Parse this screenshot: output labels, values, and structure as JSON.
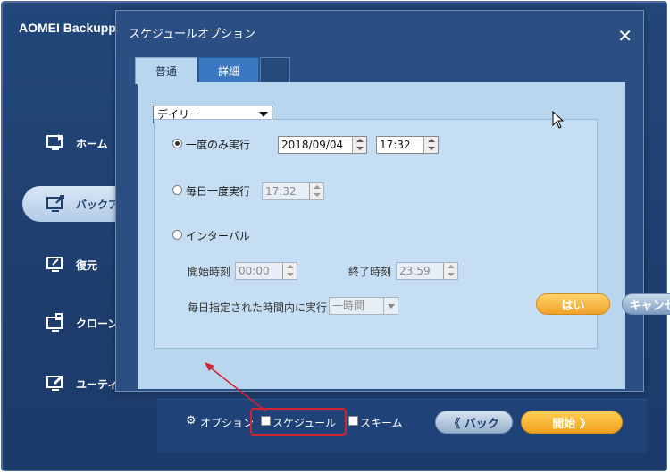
{
  "main": {
    "title": "AOMEI Backupper",
    "nav": [
      {
        "label": "ホーム",
        "icon": "home-icon"
      },
      {
        "label": "バックアップ",
        "icon": "backup-icon"
      },
      {
        "label": "復元",
        "icon": "restore-icon"
      },
      {
        "label": "クローン",
        "icon": "clone-icon"
      },
      {
        "label": "ユーティリティ",
        "icon": "tools-icon"
      }
    ],
    "active_nav": "バックアップ",
    "bottom": {
      "options_label": "オプション",
      "schedule_label": "スケジュール",
      "scheme_label": "スキーム",
      "back_label": "《 バック",
      "start_label": "開始 》"
    }
  },
  "dialog": {
    "title": "スケジュールオプション",
    "tabs": [
      "普通",
      "詳細"
    ],
    "active_tab": "普通",
    "frequency": {
      "selected": "デイリー"
    },
    "once": {
      "label": "一度のみ実行",
      "date": "2018/09/04",
      "time": "17:32",
      "checked": true
    },
    "daily_once": {
      "label": "毎日一度実行",
      "time": "17:32",
      "checked": false
    },
    "interval": {
      "label": "インターバル",
      "checked": false,
      "start_label": "開始時刻",
      "start_time": "00:00",
      "end_label": "終了時刻",
      "end_time": "23:59",
      "within_label": "毎日指定された時間内に実行",
      "within_value": "一時間"
    },
    "ok_label": "はい",
    "cancel_label": "キャンセル"
  },
  "colors": {
    "main_bg": "#1f4174",
    "dialog_panel": "#b9d6ef",
    "accent_orange": "#f0a12a",
    "highlight_red": "#d4212e"
  }
}
